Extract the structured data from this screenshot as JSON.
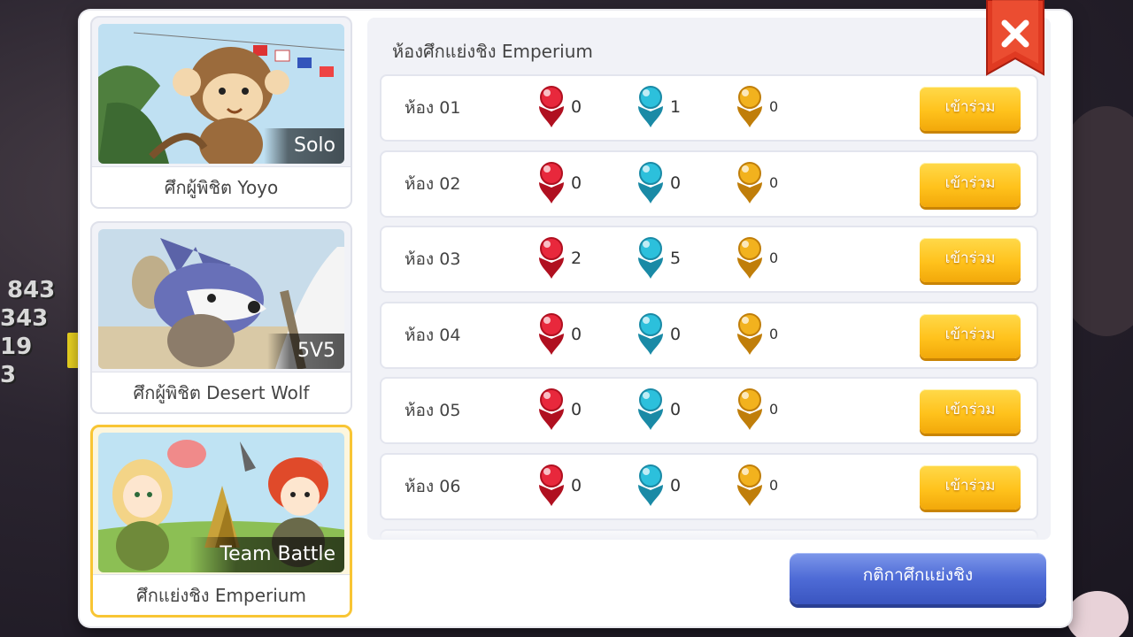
{
  "background_hud": [
    "843",
    "343",
    "19",
    "3"
  ],
  "modes": [
    {
      "tag": "Solo",
      "label": "ศึกผู้พิชิต Yoyo",
      "selected": false
    },
    {
      "tag": "5V5",
      "label": "ศึกผู้พิชิต Desert Wolf",
      "selected": false
    },
    {
      "tag": "Team Battle",
      "label": "ศึกแย่งชิง Emperium",
      "selected": true
    }
  ],
  "panel": {
    "title": "ห้องศึกแย่งชิง Emperium",
    "join_label": "เข้าร่วม",
    "rooms": [
      {
        "name": "ห้อง 01",
        "red": "0",
        "blue": "1",
        "gold": "0"
      },
      {
        "name": "ห้อง 02",
        "red": "0",
        "blue": "0",
        "gold": "0"
      },
      {
        "name": "ห้อง 03",
        "red": "2",
        "blue": "5",
        "gold": "0"
      },
      {
        "name": "ห้อง 04",
        "red": "0",
        "blue": "0",
        "gold": "0"
      },
      {
        "name": "ห้อง 05",
        "red": "0",
        "blue": "0",
        "gold": "0"
      },
      {
        "name": "ห้อง 06",
        "red": "0",
        "blue": "0",
        "gold": "0"
      }
    ]
  },
  "rules_button": "กติกาศึกแย่งชิง",
  "colors": {
    "red_team": "#e8283c",
    "blue_team": "#2cc0dc",
    "gold_team": "#f2b21e",
    "join": "#ffc21c",
    "rules": "#4e6bd6",
    "close": "#e03a22"
  }
}
